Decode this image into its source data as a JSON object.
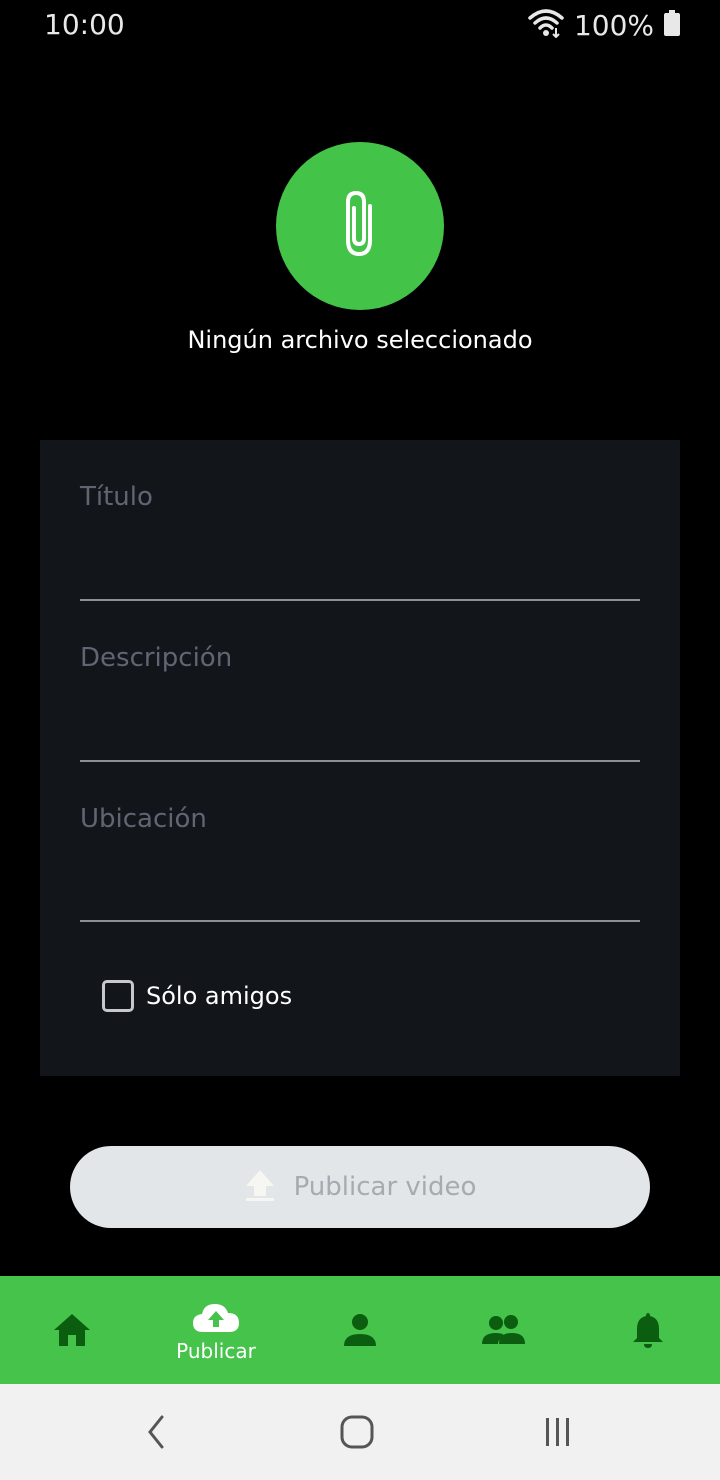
{
  "status_bar": {
    "time": "10:00",
    "battery": "100%",
    "icons": [
      "wifi-icon",
      "battery-icon"
    ]
  },
  "attach": {
    "icon": "paperclip-icon",
    "file_status": "Ningún archivo seleccionado"
  },
  "form": {
    "title_placeholder": "Título",
    "title_value": "",
    "description_placeholder": "Descripción",
    "description_value": "",
    "location_placeholder": "Ubicación",
    "location_value": "",
    "friends_only_label": "Sólo amigos",
    "friends_only_checked": false
  },
  "publish": {
    "label": "Publicar video",
    "icon": "upload-icon",
    "enabled": false
  },
  "bottom_nav": {
    "items": [
      {
        "icon": "home-icon",
        "label": ""
      },
      {
        "icon": "cloud-upload-icon",
        "label": "Publicar",
        "active": true
      },
      {
        "icon": "person-icon",
        "label": ""
      },
      {
        "icon": "people-icon",
        "label": ""
      },
      {
        "icon": "bell-icon",
        "label": ""
      }
    ]
  },
  "system_nav": {
    "buttons": [
      "back-icon",
      "home-circle-icon",
      "recents-icon"
    ]
  },
  "colors": {
    "accent": "#44c349",
    "nav_icon": "#0b5e10",
    "card_bg": "#12151a",
    "placeholder": "#5f6572",
    "disabled_button": "#e2e6e9",
    "disabled_text": "#a5abb1"
  }
}
